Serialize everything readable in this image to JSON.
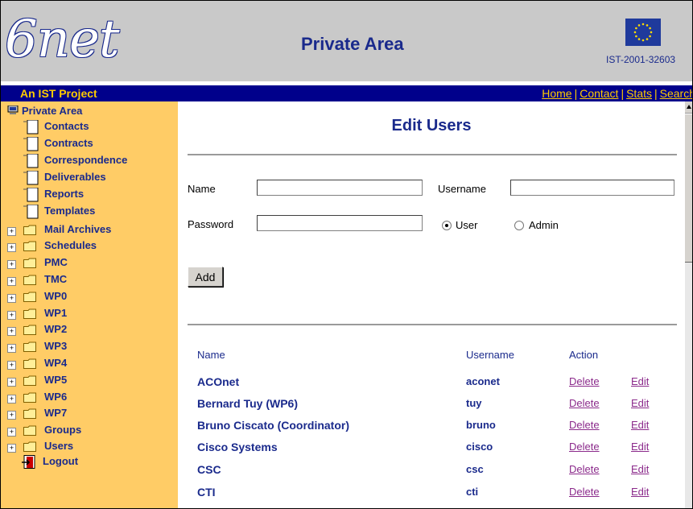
{
  "header": {
    "logo_text": "6net",
    "title": "Private Area",
    "ist_code": "IST-2001-32603"
  },
  "navbar": {
    "project": "An IST Project",
    "links": [
      "Home",
      "Contact",
      "Stats",
      "Search"
    ],
    "separator": "|"
  },
  "sidebar": {
    "root": "Private Area",
    "documents": [
      "Contacts",
      "Contracts",
      "Correspondence",
      "Deliverables",
      "Reports",
      "Templates"
    ],
    "folders": [
      "Mail Archives",
      "Schedules",
      "PMC",
      "TMC",
      "WP0",
      "WP1",
      "WP2",
      "WP3",
      "WP4",
      "WP5",
      "WP6",
      "WP7",
      "Groups",
      "Users"
    ],
    "logout": "Logout"
  },
  "main": {
    "title": "Edit Users",
    "form": {
      "name_label": "Name",
      "username_label": "Username",
      "password_label": "Password",
      "name_value": "",
      "username_value": "",
      "password_value": "",
      "role_user": "User",
      "role_admin": "Admin",
      "role_selected": "User",
      "add_label": "Add"
    },
    "table": {
      "headers": [
        "Name",
        "Username",
        "Action"
      ],
      "delete_label": "Delete",
      "edit_label": "Edit",
      "rows": [
        {
          "name": "ACOnet",
          "username": "aconet"
        },
        {
          "name": "Bernard Tuy (WP6)",
          "username": "tuy"
        },
        {
          "name": "Bruno Ciscato (Coordinator)",
          "username": "bruno"
        },
        {
          "name": "Cisco Systems",
          "username": "cisco"
        },
        {
          "name": "CSC",
          "username": "csc"
        },
        {
          "name": "CTI",
          "username": "cti"
        }
      ]
    }
  },
  "colors": {
    "header_bg": "#c9c9c9",
    "navbar_bg": "#00008b",
    "navbar_text": "#ffcc00",
    "sidebar_bg": "#ffcc66",
    "title_text": "#1a2a8c",
    "link_visited": "#8b2a8b"
  },
  "icons": {
    "root": "computer-icon",
    "document": "document-icon",
    "folder": "folder-icon",
    "expand": "plus-icon",
    "logout": "logout-door-icon",
    "flag": "eu-flag-icon"
  }
}
